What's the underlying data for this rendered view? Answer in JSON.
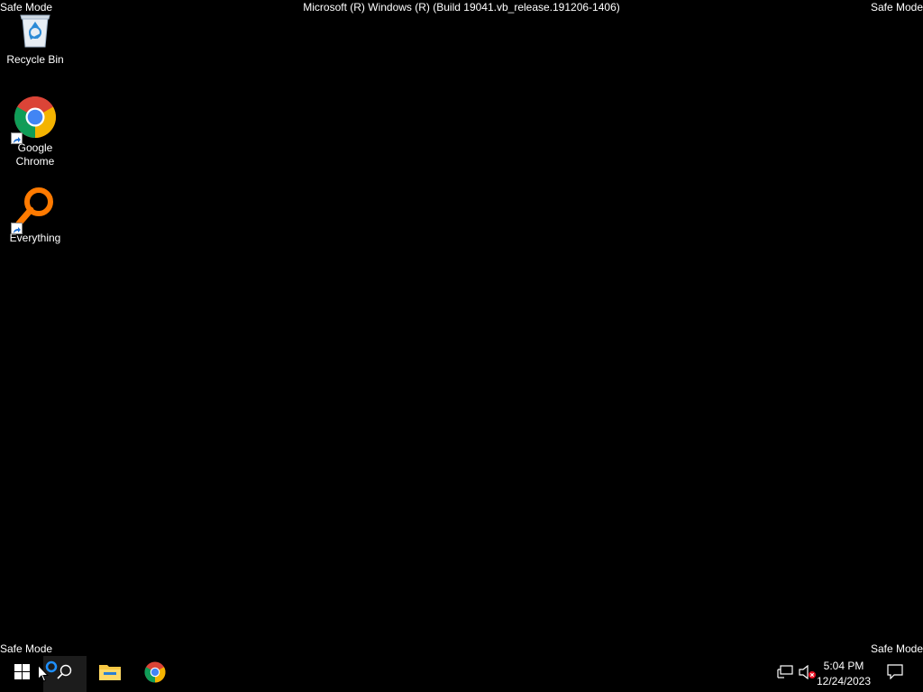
{
  "watermarks": {
    "top_left": "Safe Mode",
    "top_right": "Safe Mode",
    "bottom_left": "Safe Mode",
    "bottom_right": "Safe Mode",
    "title": "Microsoft (R) Windows (R) (Build 19041.vb_release.191206-1406)"
  },
  "desktop_icons": [
    {
      "label": "Recycle Bin",
      "icon": "recycle-bin-icon"
    },
    {
      "label": "Google Chrome",
      "icon": "chrome-icon"
    },
    {
      "label": "Everything",
      "icon": "everything-icon"
    }
  ],
  "taskbar": {
    "start": "windows-logo-icon",
    "search": "search-icon",
    "pinned": [
      "file-explorer-icon",
      "chrome-icon"
    ],
    "tray": {
      "network": "network-icon",
      "volume": "volume-muted-icon",
      "time": "5:04 PM",
      "date": "12/24/2023",
      "notifications": "action-center-icon"
    }
  },
  "colors": {
    "background": "#000000",
    "text": "#ffffff",
    "taskbar": "#000000"
  }
}
